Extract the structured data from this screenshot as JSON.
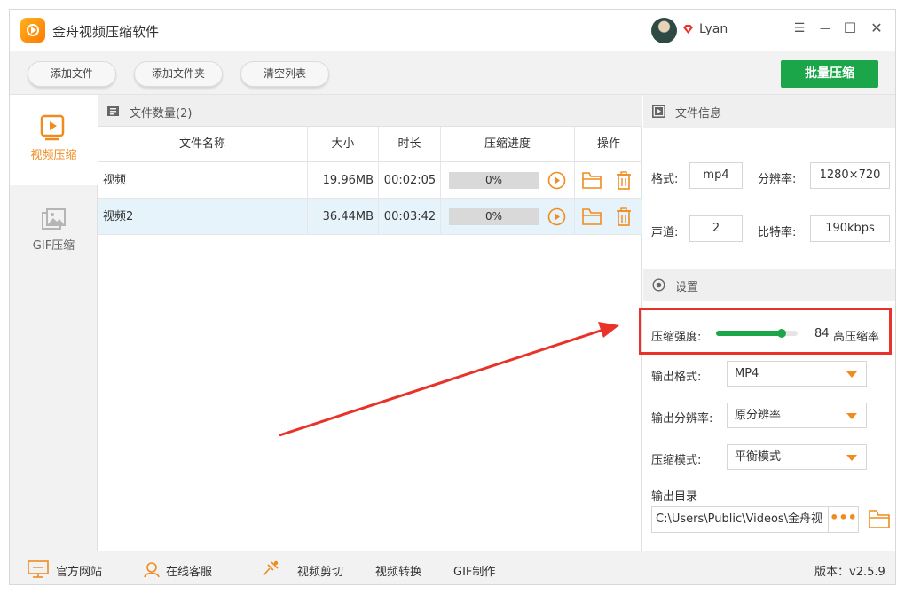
{
  "app": {
    "title": "金舟视频压缩软件",
    "username": "Lyan"
  },
  "window_controls": {
    "menu": "☰",
    "minimize": "—",
    "maximize": "☐",
    "close": "✕"
  },
  "toolbar": {
    "add_file": "添加文件",
    "add_folder": "添加文件夹",
    "clear_list": "清空列表",
    "batch_compress": "批量压缩"
  },
  "nav": [
    {
      "label": "视频压缩",
      "icon": "video-play-icon",
      "active": true
    },
    {
      "label": "GIF压缩",
      "icon": "image-icon",
      "active": false
    }
  ],
  "files": {
    "count_label": "文件数量(2)",
    "columns": [
      "文件名称",
      "大小",
      "时长",
      "压缩进度",
      "操作"
    ],
    "rows": [
      {
        "name": "视频",
        "size": "19.96MB",
        "duration": "00:02:05",
        "progress": "0%",
        "progress_value": 0,
        "selected": false
      },
      {
        "name": "视频2",
        "size": "36.44MB",
        "duration": "00:03:42",
        "progress": "0%",
        "progress_value": 0,
        "selected": true
      }
    ]
  },
  "file_info": {
    "title": "文件信息",
    "format_label": "格式:",
    "format": "mp4",
    "resolution_label": "分辨率:",
    "resolution": "1280×720",
    "channels_label": "声道:",
    "channels": "2",
    "bitrate_label": "比特率:",
    "bitrate": "190kbps"
  },
  "settings": {
    "title": "设置",
    "strength_label": "压缩强度:",
    "strength_value": "84",
    "strength_level": 84,
    "strength_text": "高压缩率",
    "output_format_label": "输出格式:",
    "output_format": "MP4",
    "output_resolution_label": "输出分辨率:",
    "output_resolution": "原分辨率",
    "mode_label": "压缩模式:",
    "mode": "平衡模式",
    "output_dir_label": "输出目录",
    "output_dir": "C:\\Users\\Public\\Videos\\金舟视",
    "more": "•••"
  },
  "bottom": {
    "website": "官方网站",
    "support": "在线客服",
    "video_cut": "视频剪切",
    "video_convert": "视频转换",
    "gif_make": "GIF制作",
    "version": "版本：v2.5.9"
  },
  "colors": {
    "accent": "#f08c1e",
    "green": "#1ba64a",
    "highlight": "#e8322a",
    "selected_row": "#e6f3fb"
  }
}
